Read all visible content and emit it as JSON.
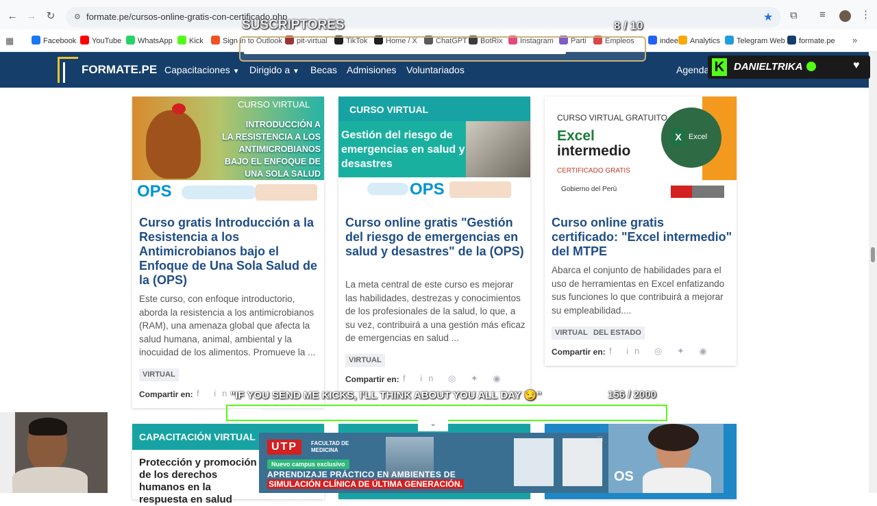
{
  "browser": {
    "url": "formate.pe/cursos-online-gratis-con-certificado.php",
    "bookmarks": [
      "Facebook",
      "YouTube",
      "WhatsApp",
      "Kick",
      "Sign in to Outlook",
      "pit-virtual",
      "TikTok",
      "Home / X",
      "ChatGPT",
      "BotRix",
      "Instagram",
      "Parti",
      "Empleos",
      "indeed",
      "Analytics",
      "Telegram Web",
      "formate.pe"
    ],
    "bookmark_colors": [
      "#1877f2",
      "#ff0000",
      "#25d366",
      "#53fc18",
      "#f25022",
      "#8b1a1a",
      "#000000",
      "#000000",
      "#444444",
      "#222222",
      "#e1306c",
      "#6b46c1",
      "#d32f2f",
      "#2164f3",
      "#f9ab00",
      "#229ed9",
      "#153e6a"
    ]
  },
  "site": {
    "logo": "FORMATE.PE",
    "nav": [
      "Capacitaciones",
      "Dirigido a",
      "Becas",
      "Admisiones",
      "Voluntariados"
    ],
    "nav_right": "Agenda"
  },
  "cards": [
    {
      "badge": "CURSO VIRTUAL",
      "banner_lines": [
        "INTRODUCCIÓN A",
        "LA RESISTENCIA A LOS",
        "ANTIMICROBIANOS",
        "BAJO EL ENFOQUE DE",
        "UNA SOLA SALUD"
      ],
      "org": "OPS",
      "title": "Curso gratis Introducción a la Resistencia a los Antimicrobianos bajo el Enfoque de Una Sola Salud de la (OPS)",
      "desc": "Este curso, con enfoque introductorio, aborda la resistencia a los antimicrobianos (RAM), una amenaza global que afecta la salud humana, animal, ambiental y la inocuidad de los alimentos. Promueve la ...",
      "tags": [
        "VIRTUAL"
      ],
      "share": "Compartir en:"
    },
    {
      "badge": "CURSO VIRTUAL",
      "banner_lines": [
        "Gestión del riesgo de",
        "emergencias en salud y",
        "desastres"
      ],
      "org": "OPS",
      "title": "Curso online gratis \"Gestión del riesgo de emergencias en salud y desastres\" de la (OPS)",
      "desc": "La meta central de este curso es mejorar las habilidades, destrezas y conocimientos de los profesionales de la salud, lo que, a su vez, contribuirá a una gestión más eficaz de emergencias en salud ...",
      "tags": [
        "VIRTUAL"
      ],
      "share": "Compartir en:"
    },
    {
      "badge": "CURSO VIRTUAL GRATUITO",
      "banner_lines": [
        "Excel",
        "intermedio",
        "CERTIFICADO GRATIS"
      ],
      "org": "Gobierno del Perú",
      "title": "Curso online gratis certificado: \"Excel intermedio\" del MTPE",
      "desc": "Abarca el conjunto de habilidades para el uso de herramientas en Excel enfatizando sus funciones lo que contribuirá a mejorar su empleabilidad....",
      "tags": [
        "VIRTUAL",
        "DEL ESTADO"
      ],
      "share": "Compartir en:"
    }
  ],
  "bottom_cards": [
    {
      "badge": "CAPACITACIÓN VIRTUAL",
      "title": "Protección y promoción de los derechos humanos en la respuesta en salud"
    }
  ],
  "overlays": {
    "subs_label": "SUSCRIPTORES",
    "subs_count": "8 / 10",
    "streamer": "DANIELTRIKA",
    "kicks_text": "\"IF YOU SEND ME KICKS, I'LL THINK ABOUT YOU ALL DAY 😏\"",
    "kicks_count": "156 / 2000"
  },
  "ad": {
    "brand": "UTP",
    "faculty": "FACULTAD DE MEDICINA",
    "pill": "Nuevo campus exclusivo",
    "line1": "APRENDIZAJE PRÁCTICO EN AMBIENTES DE",
    "line2": "SIMULACIÓN CLÍNICA DE ÚLTIMA GENERACIÓN."
  },
  "colors": {
    "brand_blue": "#153e6a",
    "title_blue": "#1f4d86",
    "teal": "#17a3a3",
    "kick_green": "#53fc18"
  }
}
